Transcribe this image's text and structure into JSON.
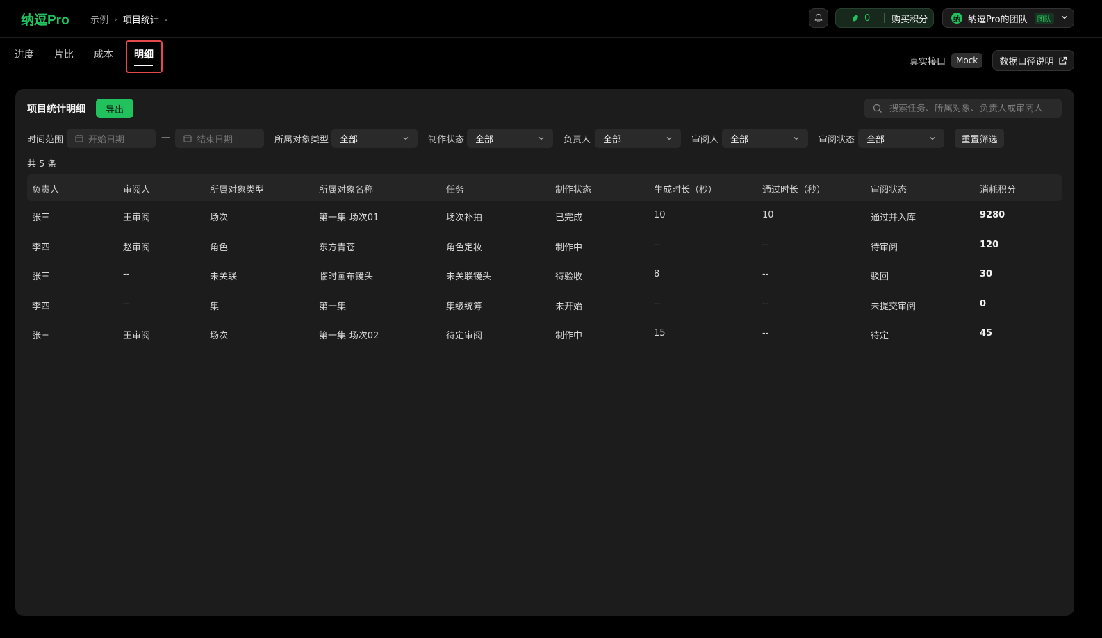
{
  "app": {
    "logo": "纳逗Pro",
    "breadcrumb": {
      "root": "示例",
      "current": "项目统计"
    }
  },
  "header": {
    "points_count": "0",
    "buy_points_label": "购买积分",
    "team_avatar": "纳",
    "team_name": "纳逗Pro的团队",
    "team_badge": "团队"
  },
  "tabs": [
    {
      "label": "进度"
    },
    {
      "label": "片比"
    },
    {
      "label": "成本"
    },
    {
      "label": "明细",
      "active": true
    }
  ],
  "source": {
    "real_label": "真实接口",
    "mock_label": "Mock",
    "doc_label": "数据口径说明"
  },
  "card": {
    "title": "项目统计明细",
    "export_label": "导出",
    "search_placeholder": "搜索任务、所属对象、负责人或审阅人"
  },
  "filters": {
    "time_label": "时间范围",
    "start_placeholder": "开始日期",
    "dash": "—",
    "end_placeholder": "结束日期",
    "object_type_label": "所属对象类型",
    "object_type_value": "全部",
    "prod_status_label": "制作状态",
    "prod_status_value": "全部",
    "owner_label": "负责人",
    "owner_value": "全部",
    "reviewer_label": "审阅人",
    "reviewer_value": "全部",
    "review_status_label": "审阅状态",
    "review_status_value": "全部",
    "reset_label": "重置筛选"
  },
  "total": "共 5 条",
  "table": {
    "columns": [
      "负责人",
      "审阅人",
      "所属对象类型",
      "所属对象名称",
      "任务",
      "制作状态",
      "生成时长（秒）",
      "通过时长（秒）",
      "审阅状态",
      "消耗积分"
    ],
    "rows": [
      [
        "张三",
        "王审阅",
        "场次",
        "第一集-场次01",
        "场次补拍",
        "已完成",
        "10",
        "10",
        "通过并入库",
        "9280"
      ],
      [
        "李四",
        "赵审阅",
        "角色",
        "东方青苍",
        "角色定妆",
        "制作中",
        "--",
        "--",
        "待审阅",
        "120"
      ],
      [
        "张三",
        "--",
        "未关联",
        "临时画布镜头",
        "未关联镜头",
        "待验收",
        "8",
        "--",
        "驳回",
        "30"
      ],
      [
        "李四",
        "--",
        "集",
        "第一集",
        "集级统筹",
        "未开始",
        "--",
        "--",
        "未提交审阅",
        "0"
      ],
      [
        "张三",
        "王审阅",
        "场次",
        "第一集-场次02",
        "待定审阅",
        "制作中",
        "15",
        "--",
        "待定",
        "45"
      ]
    ]
  },
  "colors": {
    "accent": "#21c25e",
    "highlight": "#e5484d",
    "card": "#1c1c1c",
    "background": "#000000"
  }
}
